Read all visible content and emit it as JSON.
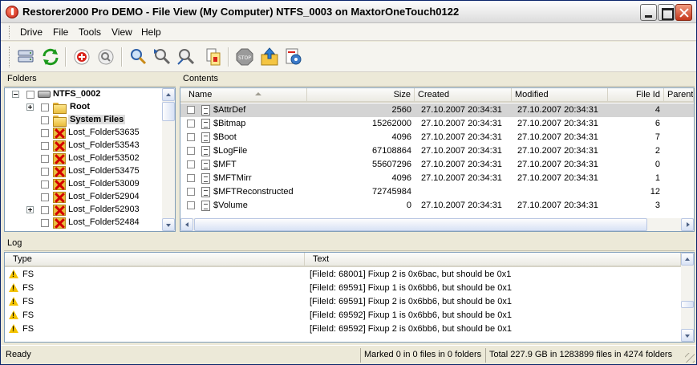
{
  "window": {
    "title": "Restorer2000 Pro DEMO - File View (My Computer) NTFS_0003 on MaxtorOneTouch0122"
  },
  "menu": [
    "Drive",
    "File",
    "Tools",
    "View",
    "Help"
  ],
  "toolbar": {
    "icons": [
      "drives-icon",
      "refresh-icon",
      "add-icon",
      "zoom-icon",
      "search-icon",
      "find-next-icon",
      "find-all-icon",
      "file-info-icon",
      "stop-icon",
      "recover-icon",
      "settings-icon"
    ]
  },
  "folders": {
    "header": "Folders",
    "items": [
      {
        "label": "NTFS_0002",
        "kind": "drive"
      },
      {
        "label": "Root",
        "kind": "folder"
      },
      {
        "label": "System Files",
        "kind": "folder"
      },
      {
        "label": "Lost_Folder53635",
        "kind": "lost"
      },
      {
        "label": "Lost_Folder53543",
        "kind": "lost"
      },
      {
        "label": "Lost_Folder53502",
        "kind": "lost"
      },
      {
        "label": "Lost_Folder53475",
        "kind": "lost"
      },
      {
        "label": "Lost_Folder53009",
        "kind": "lost"
      },
      {
        "label": "Lost_Folder52904",
        "kind": "lost"
      },
      {
        "label": "Lost_Folder52903",
        "kind": "lost"
      },
      {
        "label": "Lost_Folder52484",
        "kind": "lost"
      }
    ]
  },
  "contents": {
    "header": "Contents",
    "columns": {
      "name": "Name",
      "size": "Size",
      "created": "Created",
      "modified": "Modified",
      "file_id": "File Id",
      "parent": "Parent"
    },
    "rows": [
      {
        "name": "$AttrDef",
        "size": "2560",
        "created": "27.10.2007 20:34:31",
        "modified": "27.10.2007 20:34:31",
        "file_id": "4"
      },
      {
        "name": "$Bitmap",
        "size": "15262000",
        "created": "27.10.2007 20:34:31",
        "modified": "27.10.2007 20:34:31",
        "file_id": "6"
      },
      {
        "name": "$Boot",
        "size": "4096",
        "created": "27.10.2007 20:34:31",
        "modified": "27.10.2007 20:34:31",
        "file_id": "7"
      },
      {
        "name": "$LogFile",
        "size": "67108864",
        "created": "27.10.2007 20:34:31",
        "modified": "27.10.2007 20:34:31",
        "file_id": "2"
      },
      {
        "name": "$MFT",
        "size": "55607296",
        "created": "27.10.2007 20:34:31",
        "modified": "27.10.2007 20:34:31",
        "file_id": "0"
      },
      {
        "name": "$MFTMirr",
        "size": "4096",
        "created": "27.10.2007 20:34:31",
        "modified": "27.10.2007 20:34:31",
        "file_id": "1"
      },
      {
        "name": "$MFTReconstructed",
        "size": "72745984",
        "created": "",
        "modified": "",
        "file_id": "12"
      },
      {
        "name": "$Volume",
        "size": "0",
        "created": "27.10.2007 20:34:31",
        "modified": "27.10.2007 20:34:31",
        "file_id": "3"
      }
    ]
  },
  "log": {
    "header": "Log",
    "columns": {
      "type": "Type",
      "text": "Text"
    },
    "rows": [
      {
        "type": "FS",
        "text": "[FileId: 68001] Fixup 2 is 0x6bac, but should be 0x1"
      },
      {
        "type": "FS",
        "text": "[FileId: 69591] Fixup 1 is 0x6bb6, but should be 0x1"
      },
      {
        "type": "FS",
        "text": "[FileId: 69591] Fixup 2 is 0x6bb6, but should be 0x1"
      },
      {
        "type": "FS",
        "text": "[FileId: 69592] Fixup 1 is 0x6bb6, but should be 0x1"
      },
      {
        "type": "FS",
        "text": "[FileId: 69592] Fixup 2 is 0x6bb6, but should be 0x1"
      }
    ]
  },
  "status": {
    "ready": "Ready",
    "marked": "Marked 0 in 0 files in 0 folders",
    "total": "Total 227.9 GB in 1283899 files in 4274 folders"
  }
}
